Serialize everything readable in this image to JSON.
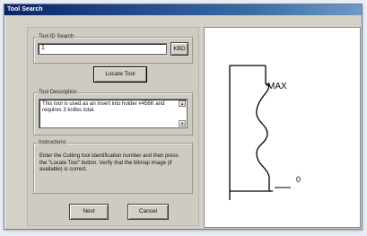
{
  "window": {
    "title": "Tool Search"
  },
  "search": {
    "group_label": "Tool ID Search",
    "value": "1",
    "kbd_label": "KBD",
    "locate_label": "Locate Tool"
  },
  "description": {
    "group_label": "Tool Description",
    "text": "This tool is used as an insert into holder #456K and requires 3 knifes total.",
    "scroll_up": "▲",
    "scroll_down": "▼"
  },
  "instructions": {
    "group_label": "Instructions",
    "text": "Enter the Cutting tool identification number and then press the \"Locate Tool\" button.  Verify that the bitmap image (if available) is correct."
  },
  "buttons": {
    "next_label": "Next",
    "cancel_label": "Cancel"
  },
  "tool_image": {
    "max_label": "MAX",
    "zero_label": "0"
  }
}
